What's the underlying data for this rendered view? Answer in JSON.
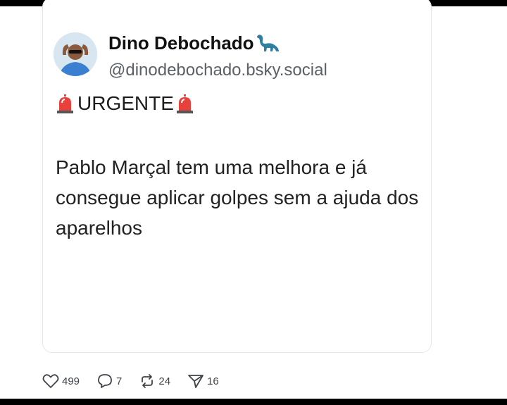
{
  "post": {
    "author_name": "Dino Debochado",
    "author_emoji_icon": "sauropod-dinosaur-icon",
    "handle": "@dinodebochado.bsky.social",
    "urgent_label": "URGENTE",
    "siren_icon": "police-siren-icon",
    "body": "Pablo Marçal tem uma melhora e já consegue aplicar golpes sem a ajuda dos aparelhos"
  },
  "actions": {
    "likes": "499",
    "replies": "7",
    "reposts": "24",
    "shares": "16"
  },
  "colors": {
    "frame": "#000000",
    "siren_red": "#e8403a",
    "dino_teal": "#2e7fa0",
    "handle_gray": "#5b6168"
  }
}
